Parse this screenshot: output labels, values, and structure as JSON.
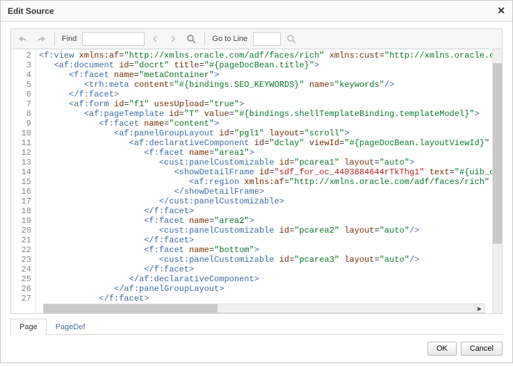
{
  "dialog": {
    "title": "Edit Source"
  },
  "toolbar": {
    "find_label": "Find",
    "goto_label": "Go to Line"
  },
  "tabs": {
    "page": "Page",
    "pagedef": "PageDef"
  },
  "buttons": {
    "ok": "OK",
    "cancel": "Cancel"
  },
  "gutter": [
    "2",
    "3",
    "4",
    "5",
    "6",
    "7",
    "8",
    "9",
    "10",
    "11",
    "12",
    "13",
    "14",
    "15",
    "16",
    "17",
    "18",
    "19",
    "20",
    "21",
    "22",
    "23",
    "24",
    "25",
    "26",
    "27"
  ],
  "code_lines": [
    {
      "indent": 0,
      "type": "open",
      "tag": "f:view",
      "attrs": [
        [
          "xmlns:af",
          "\"http://xmlns.oracle.com/adf/faces/rich\""
        ],
        [
          "xmlns:cust",
          "\"http://xmlns.oracle.co"
        ]
      ],
      "self": false,
      "clip": true
    },
    {
      "indent": 1,
      "type": "open",
      "tag": "af:document",
      "attrs": [
        [
          "id",
          "\"docrt\""
        ],
        [
          "title",
          "\"#{pageDocBean.title}\""
        ]
      ],
      "self": false
    },
    {
      "indent": 2,
      "type": "open",
      "tag": "f:facet",
      "attrs": [
        [
          "name",
          "\"metaContainer\""
        ]
      ],
      "self": false
    },
    {
      "indent": 3,
      "type": "self",
      "tag": "trh:meta",
      "attrs": [
        [
          "content",
          "\"#{bindings.SEO_KEYWORDS}\""
        ],
        [
          "name",
          "\"keywords\""
        ]
      ]
    },
    {
      "indent": 2,
      "type": "close",
      "tag": "f:facet"
    },
    {
      "indent": 2,
      "type": "open",
      "tag": "af:form",
      "attrs": [
        [
          "id",
          "\"f1\""
        ],
        [
          "usesUpload",
          "\"true\""
        ]
      ],
      "self": false
    },
    {
      "indent": 3,
      "type": "open",
      "tag": "af:pageTemplate",
      "attrs": [
        [
          "id",
          "\"T\""
        ],
        [
          "value",
          "\"#{bindings.shellTemplateBinding.templateModel}\""
        ]
      ],
      "self": false
    },
    {
      "indent": 4,
      "type": "open",
      "tag": "f:facet",
      "attrs": [
        [
          "name",
          "\"content\""
        ]
      ],
      "self": false
    },
    {
      "indent": 5,
      "type": "open",
      "tag": "af:panelGroupLayout",
      "attrs": [
        [
          "id",
          "\"pgl1\""
        ],
        [
          "layout",
          "\"scroll\""
        ]
      ],
      "self": false
    },
    {
      "indent": 6,
      "type": "open",
      "tag": "af:declarativeComponent",
      "attrs": [
        [
          "id",
          "\"dclay\""
        ],
        [
          "viewId",
          "\"#{pageDocBean.layoutViewId}\""
        ]
      ],
      "self": false,
      "clip": true
    },
    {
      "indent": 7,
      "type": "open",
      "tag": "f:facet",
      "attrs": [
        [
          "name",
          "\"area1\""
        ]
      ],
      "self": false
    },
    {
      "indent": 8,
      "type": "open",
      "tag": "cust:panelCustomizable",
      "attrs": [
        [
          "id",
          "\"pcarea1\""
        ],
        [
          "layout",
          "\"auto\""
        ]
      ],
      "self": false
    },
    {
      "indent": 9,
      "type": "open",
      "tag": "showDetailFrame",
      "attrs": [
        [
          "id",
          "\"sdf_for_oc_4403884644rTkThg1\""
        ],
        [
          "text",
          "\"#{uib_o"
        ]
      ],
      "self": false,
      "clip": true,
      "id_red": true
    },
    {
      "indent": 10,
      "type": "open",
      "tag": "af:region",
      "attrs": [
        [
          "xmlns:af",
          "\"http://xmlns.oracle.com/adf/faces/rich\""
        ]
      ],
      "self": false,
      "clip": true
    },
    {
      "indent": 9,
      "type": "close",
      "tag": "showDetailFrame"
    },
    {
      "indent": 8,
      "type": "close",
      "tag": "cust:panelCustomizable"
    },
    {
      "indent": 7,
      "type": "close",
      "tag": "f:facet"
    },
    {
      "indent": 7,
      "type": "open",
      "tag": "f:facet",
      "attrs": [
        [
          "name",
          "\"area2\""
        ]
      ],
      "self": false
    },
    {
      "indent": 8,
      "type": "self",
      "tag": "cust:panelCustomizable",
      "attrs": [
        [
          "id",
          "\"pcarea2\""
        ],
        [
          "layout",
          "\"auto\""
        ]
      ]
    },
    {
      "indent": 7,
      "type": "close",
      "tag": "f:facet"
    },
    {
      "indent": 7,
      "type": "open",
      "tag": "f:facet",
      "attrs": [
        [
          "name",
          "\"bottom\""
        ]
      ],
      "self": false
    },
    {
      "indent": 8,
      "type": "self",
      "tag": "cust:panelCustomizable",
      "attrs": [
        [
          "id",
          "\"pcarea3\""
        ],
        [
          "layout",
          "\"auto\""
        ]
      ]
    },
    {
      "indent": 7,
      "type": "close",
      "tag": "f:facet"
    },
    {
      "indent": 6,
      "type": "close",
      "tag": "af:declarativeComponent"
    },
    {
      "indent": 5,
      "type": "close",
      "tag": "af:panelGroupLayout"
    },
    {
      "indent": 4,
      "type": "close",
      "tag": "f:facet"
    }
  ]
}
